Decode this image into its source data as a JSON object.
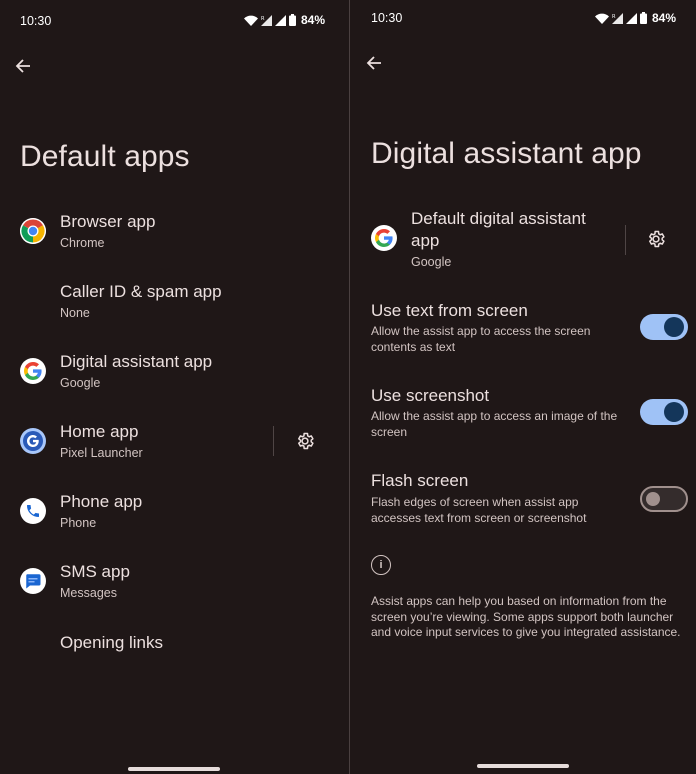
{
  "left": {
    "status": {
      "time": "10:30",
      "battery": "84%"
    },
    "title": "Default apps",
    "items": [
      {
        "label": "Browser app",
        "sub": "Chrome"
      },
      {
        "label": "Caller ID & spam app",
        "sub": "None"
      },
      {
        "label": "Digital assistant app",
        "sub": "Google"
      },
      {
        "label": "Home app",
        "sub": "Pixel Launcher"
      },
      {
        "label": "Phone app",
        "sub": "Phone"
      },
      {
        "label": "SMS app",
        "sub": "Messages"
      },
      {
        "label": "Opening links",
        "sub": ""
      }
    ]
  },
  "right": {
    "status": {
      "time": "10:30",
      "battery": "84%"
    },
    "title": "Digital assistant app",
    "default_assistant": {
      "label_line1": "Default digital assistant",
      "label_line2": "app",
      "sub": "Google"
    },
    "prefs": [
      {
        "title": "Use text from screen",
        "desc": "Allow the assist app to access the screen contents as text",
        "on": true
      },
      {
        "title": "Use screenshot",
        "desc": "Allow the assist app to access an image of the screen",
        "on": true
      },
      {
        "title": "Flash screen",
        "desc": "Flash edges of screen when assist app accesses text from screen or screenshot",
        "on": false
      }
    ],
    "info": "Assist apps can help you based on information from the screen you’re viewing. Some apps support both launcher and voice input services to give you integrated assistance."
  },
  "colors": {
    "background": "#1f1717",
    "toggle_on_track": "#9fc2f6",
    "toggle_on_knob": "#14365a",
    "toggle_off_outline": "#a0908d"
  },
  "icons": [
    "back-arrow-icon",
    "wifi-icon",
    "signal-icon",
    "battery-icon",
    "chrome-icon",
    "google-icon",
    "gear-icon",
    "phone-icon",
    "messages-icon",
    "info-icon"
  ]
}
